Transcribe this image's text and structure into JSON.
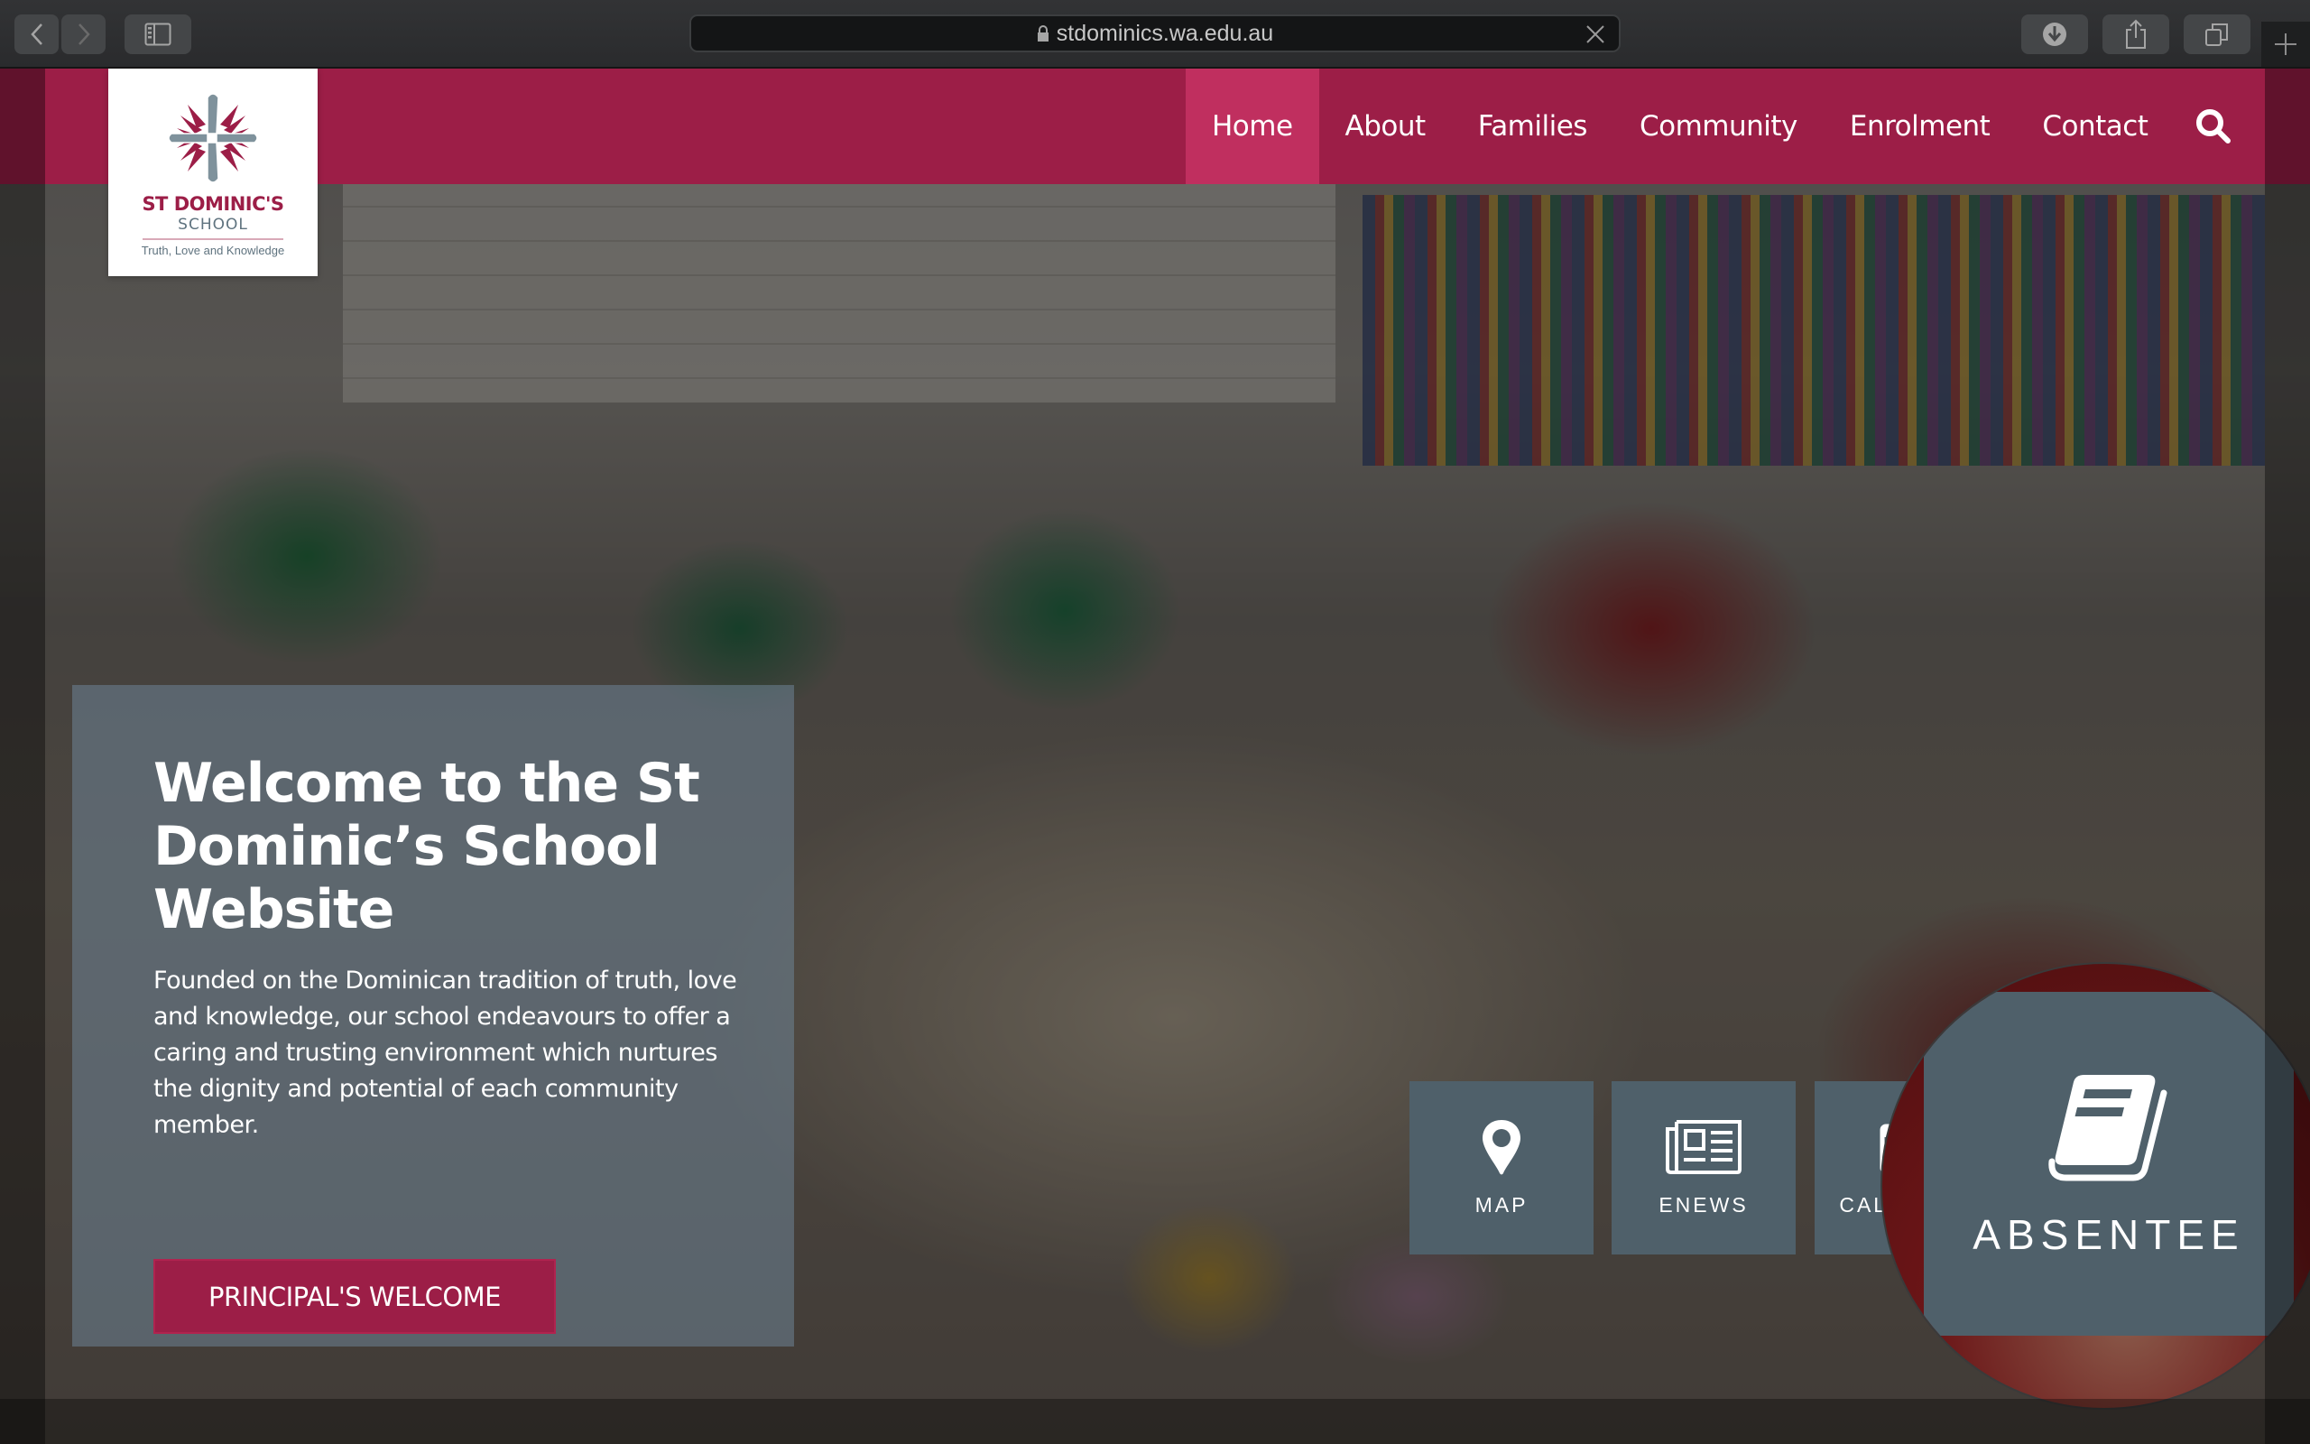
{
  "browser": {
    "url": "stdominics.wa.edu.au",
    "buttons": {
      "back": "back",
      "forward": "forward",
      "sidebar": "sidebar",
      "downloads": "downloads",
      "share": "share",
      "tabs": "tabs",
      "new_tab": "new-tab"
    }
  },
  "site": {
    "logo": {
      "name": "ST DOMINIC'S",
      "school": "SCHOOL",
      "motto": "Truth, Love and Knowledge"
    },
    "nav": {
      "items": [
        {
          "label": "Home",
          "active": true
        },
        {
          "label": "About",
          "active": false
        },
        {
          "label": "Families",
          "active": false
        },
        {
          "label": "Community",
          "active": false
        },
        {
          "label": "Enrolment",
          "active": false
        },
        {
          "label": "Contact",
          "active": false
        }
      ],
      "search_icon": "search-icon"
    },
    "welcome": {
      "title": "Welcome to the St Dominic’s School Website",
      "body": "Founded on the Dominican tradition of truth, love and knowledge, our school endeavours to offer a caring and trusting environment which nurtures the dignity and potential of each community member.",
      "button": "PRINCIPAL'S WELCOME"
    },
    "quick_links": [
      {
        "label": "MAP",
        "icon": "map-pin-icon"
      },
      {
        "label": "ENEWS",
        "icon": "newspaper-icon"
      },
      {
        "label": "CALENDAR",
        "visible_label": "CAL",
        "icon": "calendar-icon"
      },
      {
        "label": "ABSENTEE",
        "icon": "book-icon",
        "magnified": true
      }
    ]
  },
  "colors": {
    "brand": "#9c1e47",
    "nav_active": "#c02f5f",
    "tile": "#4f606a",
    "logo_gray": "#5f737f"
  }
}
